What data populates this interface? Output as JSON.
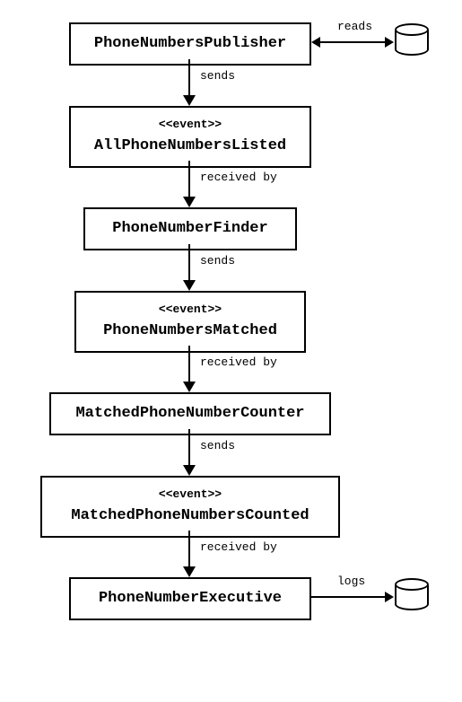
{
  "nodes": {
    "n1": {
      "title": "PhoneNumbersPublisher"
    },
    "n2": {
      "stereotype": "<<event>>",
      "title": "AllPhoneNumbersListed"
    },
    "n3": {
      "title": "PhoneNumberFinder"
    },
    "n4": {
      "stereotype": "<<event>>",
      "title": "PhoneNumbersMatched"
    },
    "n5": {
      "title": "MatchedPhoneNumberCounter"
    },
    "n6": {
      "stereotype": "<<event>>",
      "title": "MatchedPhoneNumbersCounted"
    },
    "n7": {
      "title": "PhoneNumberExecutive"
    }
  },
  "edges": {
    "e_reads": "reads",
    "e1": "sends",
    "e2": "received by",
    "e3": "sends",
    "e4": "received by",
    "e5": "sends",
    "e6": "received by",
    "e_logs": "logs"
  }
}
